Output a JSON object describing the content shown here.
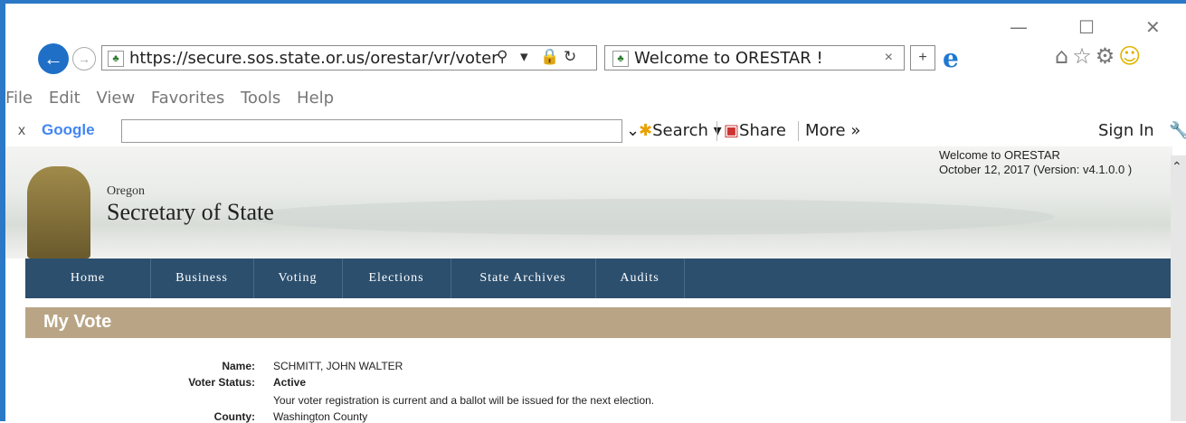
{
  "window": {
    "minimize": "—",
    "maximize": "☐",
    "close": "✕"
  },
  "address": {
    "url": "https://secure.sos.state.or.us/orestar/vr/voter"
  },
  "tab": {
    "title": "Welcome to ORESTAR !",
    "close": "×"
  },
  "menu": [
    "File",
    "Edit",
    "View",
    "Favorites",
    "Tools",
    "Help"
  ],
  "google": {
    "close": "x",
    "logo": "Google",
    "search": "Search",
    "share": "Share",
    "more": "More »",
    "signin": "Sign In"
  },
  "site": {
    "oregon": "Oregon",
    "title": "Secretary of State",
    "welcome": "Welcome to ORESTAR",
    "date_version": "October 12, 2017   (Version: v4.1.0.0 )"
  },
  "nav": [
    "Home",
    "Business",
    "Voting",
    "Elections",
    "State Archives",
    "Audits"
  ],
  "section_title": "My Vote",
  "voter": {
    "name_label": "Name:",
    "name": "SCHMITT, JOHN WALTER",
    "status_label": "Voter Status:",
    "status": "Active",
    "status_note": "Your voter registration is current and a ballot will be issued for the next election.",
    "county_label": "County:",
    "county": "Washington County"
  }
}
